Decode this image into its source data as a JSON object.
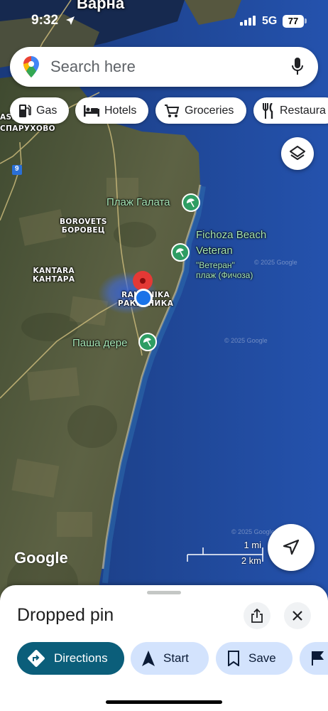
{
  "status_bar": {
    "time": "9:32",
    "network": "5G",
    "battery": "77"
  },
  "search": {
    "placeholder": "Search here"
  },
  "chips": [
    {
      "label": "Gas",
      "icon": "gas-station-icon"
    },
    {
      "label": "Hotels",
      "icon": "bed-icon"
    },
    {
      "label": "Groceries",
      "icon": "cart-icon"
    },
    {
      "label": "Restaura",
      "icon": "fork-knife-icon"
    }
  ],
  "map": {
    "place_labels": {
      "varna": "Варна",
      "asparuhovo_line1": "ASP",
      "asparuhovo_line2": "СПАРУХОВО",
      "borovets_latin": "BOROVETS",
      "borovets_cyr": "БОРОВЕЦ",
      "kantara_latin": "KANTARA",
      "kantara_cyr": "КАНТАРА",
      "rakitnika_latin": "RAKITNIKA",
      "rakitnika_cyr": "РАКИТНИКА",
      "road_number": "9"
    },
    "beaches": {
      "galata": "Плаж Галата",
      "fichoza": "Fichoza Beach",
      "veteran_line1": "Veteran",
      "veteran_line2": "\"Ветеран\"",
      "veteran_line3": "плаж (Фичоза)",
      "pasha_dere": "Паша дере"
    },
    "watermark": "© 2025 Google",
    "scale": {
      "imperial": "1 mi",
      "metric": "2 km"
    },
    "attribution": "Google"
  },
  "sheet": {
    "title": "Dropped pin",
    "actions": [
      {
        "label": "Directions",
        "icon": "directions-icon"
      },
      {
        "label": "Start",
        "icon": "navigation-arrow-icon"
      },
      {
        "label": "Save",
        "icon": "bookmark-icon"
      },
      {
        "label": "",
        "icon": "flag-icon"
      }
    ]
  },
  "colors": {
    "sea": "#1c3f86",
    "land": "#5a6040",
    "beach_pin": "#2e9d63",
    "dropped_pin": "#d93025",
    "location_dot": "#1a73e8",
    "directions_button": "#0b5e7a",
    "action_button": "#d3e3fd"
  }
}
